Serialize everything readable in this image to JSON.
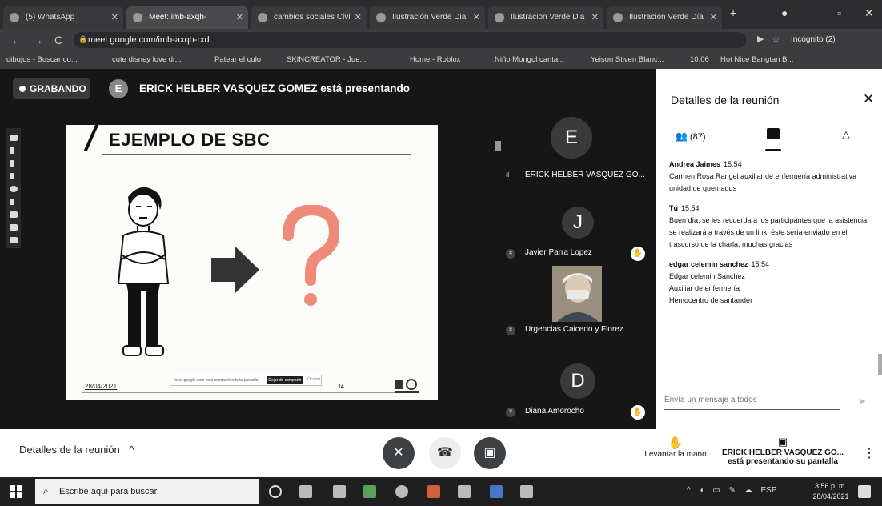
{
  "browser": {
    "tabs": [
      {
        "label": "(5) WhatsApp",
        "active": false
      },
      {
        "label": "Meet: imb-axqh-",
        "active": true
      },
      {
        "label": "cambios sociales Civi",
        "active": false
      },
      {
        "label": "Ilustración Verde Dia",
        "active": false
      },
      {
        "label": "Ilustracion Verde Dia",
        "active": false
      },
      {
        "label": "Ilustración Verde Día",
        "active": false
      }
    ],
    "new_tab": "+",
    "url": "meet.google.com/imb-axqh-rxd",
    "profile": "Incógnito (2)",
    "bookmarks": [
      "dibujos - Buscar co...",
      "cute disney love dr...",
      "Patear el culo",
      "SKINCREATOR - Jue...",
      "Home - Roblox",
      "Niño Mongol canta...",
      "Yeison Stiven Blanc...",
      "10:06",
      "Hot Nice Bangtan B..."
    ]
  },
  "meet": {
    "recording_label": "GRABANDO",
    "presenter_initial": "E",
    "presenting_text": "ERICK HELBER VASQUEZ GOMEZ está presentando",
    "slide": {
      "title": "EJEMPLO DE SBC",
      "date": "28/04/2021",
      "page_number": "14",
      "share_notice": "meet.google.com está compartiendo tu pantalla",
      "stop_label": "Dejar de compartir",
      "hide_label": "Ocultar"
    },
    "participants": [
      {
        "initial": "E",
        "name": "ERICK HELBER VASQUEZ GO...",
        "color": "#3a3a3a"
      },
      {
        "initial": "J",
        "name": "Javier Parra Lopez",
        "color": "#3a3a3a"
      },
      {
        "initial": "",
        "name": "Urgencias Caicedo y Florez",
        "color": "#3a3a3a"
      },
      {
        "initial": "D",
        "name": "Diana Amorocho",
        "color": "#3a3a3a"
      }
    ]
  },
  "panel": {
    "title": "Detalles de la reunión",
    "people_count": "(87)",
    "messages": [
      {
        "sender": "Andrea Jaimes",
        "time": "15:54",
        "lines": [
          "Carmen Rosa Rangel auxiliar de enfermería administrativa unidad de quemados"
        ]
      },
      {
        "sender": "Tú",
        "time": "15:54",
        "lines": [
          "Buen día, se les recuerda a los participantes que la asistencia se realizará a través de un link, éste sería enviado en el trascurso de la charla, muchas gracias"
        ]
      },
      {
        "sender": "edgar celemin sanchez",
        "time": "15:54",
        "lines": [
          "Edgar celemin Sanchez",
          "Auxiliar de enfermería",
          "Hemocentro de santander"
        ]
      }
    ],
    "input_placeholder": "Envía un mensaje a todos"
  },
  "bottom_bar": {
    "details_label": "Detalles de la reunión",
    "raise_hand_label": "Levantar la mano",
    "share_line1": "ERICK HELBER VASQUEZ GO...",
    "share_line2": "está presentando su pantalla"
  },
  "taskbar": {
    "search_placeholder": "Escribe aquí para buscar",
    "language": "ESP",
    "time": "3:56 p. m.",
    "date": "28/04/2021"
  },
  "colors": {
    "end_call": "#d93025",
    "muted_control": "#3c4043",
    "panel_bg": "#ffffff"
  }
}
